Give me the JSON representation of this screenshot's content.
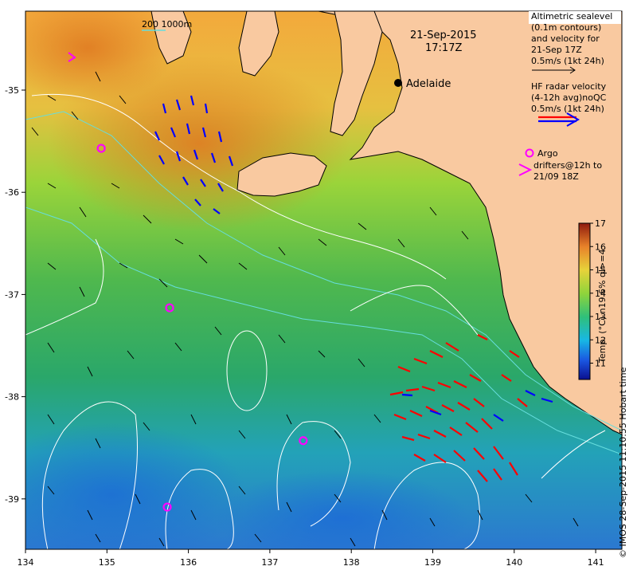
{
  "map": {
    "date": "21-Sep-2015",
    "time": "17:17Z",
    "city": "Adelaide",
    "scale_label": "200  1000m",
    "x_ticks": [
      "134",
      "135",
      "136",
      "137",
      "138",
      "139",
      "140",
      "141"
    ],
    "y_ticks": [
      "-35",
      "-36",
      "-37",
      "-38",
      "-39"
    ],
    "colors": {
      "land": "#f9c9a0",
      "hf_radar_red": "#ff0000",
      "hf_radar_blue": "#0000ff",
      "argo": "#ff00ff",
      "contour": "#ffffff",
      "isobath": "#66dddd"
    }
  },
  "legend": {
    "alt_lines": [
      "Altimetric sealevel",
      "(0.1m contours)",
      "and velocity for",
      "21-Sep 17Z",
      "0.5m/s (1kt 24h)"
    ],
    "hf_lines": [
      "HF radar velocity",
      "(4-12h avg)noQC",
      "0.5m/s (1kt 24h)"
    ],
    "argo_line1": "Argo",
    "drifters_lines": [
      "drifters@12h to",
      "21/09 18Z"
    ]
  },
  "colorbar": {
    "title": "Temp. (°C) n19 6% ql>=4",
    "ticks": [
      "11",
      "12",
      "13",
      "14",
      "15",
      "16",
      "17"
    ],
    "min": 10.3,
    "max": 17
  },
  "credit": "© IMOS 28-Sep-2015 11:10:55 Hobart time",
  "argo_floats": [
    {
      "lon": 134.93,
      "lat": -35.57,
      "label": ""
    },
    {
      "lon": 135.77,
      "lat": -37.13,
      "label": ""
    },
    {
      "lon": 137.41,
      "lat": -38.43,
      "label": ""
    },
    {
      "lon": 135.74,
      "lat": -39.08,
      "label": ""
    }
  ]
}
